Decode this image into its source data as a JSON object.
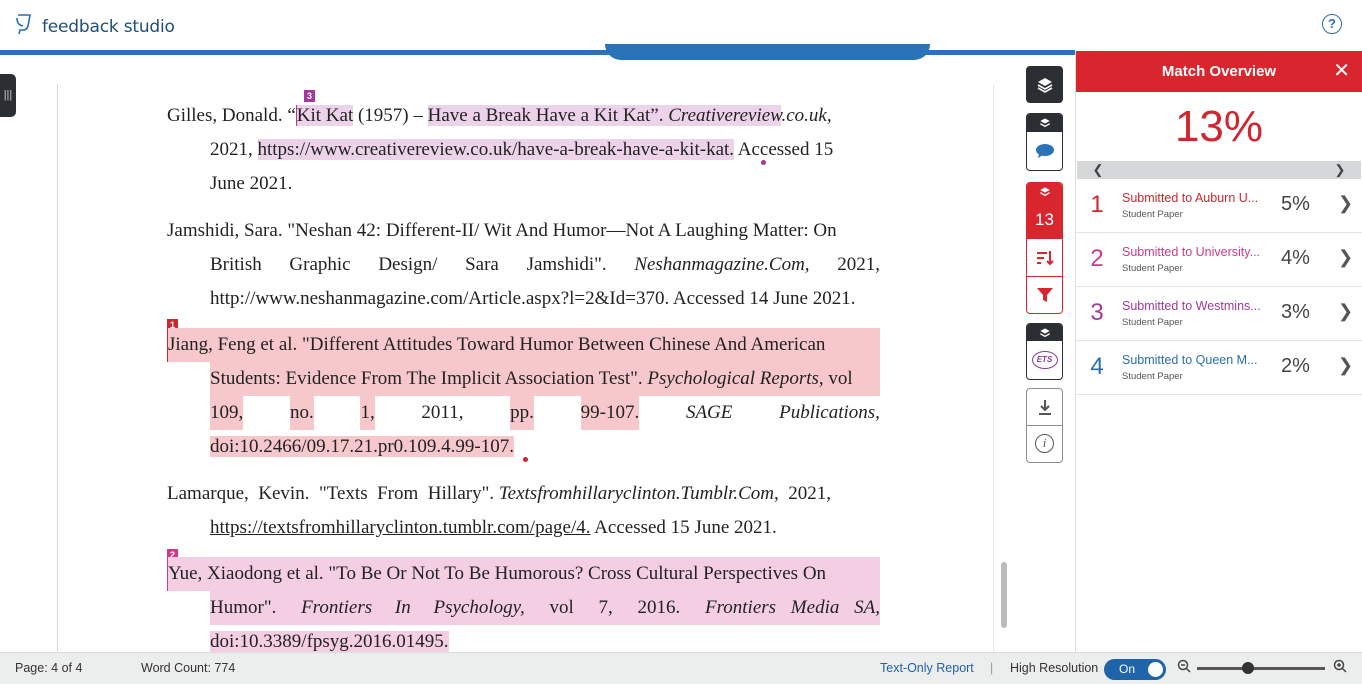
{
  "app": {
    "title": "feedback studio"
  },
  "colors": {
    "accent": "#2a73b8",
    "match_red": "#d0262f",
    "match_purple": "#a2399b",
    "match_pink": "#d0398a",
    "match_blue": "#2a6fb0"
  },
  "document": {
    "refs": [
      {
        "marker": "3",
        "line1": {
          "before": "Gilles, Donald. “",
          "hl1": "Kit Kat",
          "mid": " (1957) – ",
          "hl2": "Have a Break Have a Kit Kat”. ",
          "ital": "Creativereview",
          "after": ".co.uk,"
        },
        "line2": {
          "before": "2021,  ",
          "hl": "https://www.creativereview.co.uk/have-a-break-have-a-kit-kat.",
          "after": " Accessed 15"
        },
        "line3": "June 2021."
      },
      {
        "line1": "Jamshidi, Sara. \"Neshan 42: Different-II/ Wit And Humor—Not A Laughing Matter: On",
        "line2_words": [
          "British",
          "Graphic",
          "Design/",
          "Sara",
          "Jamshidi\".",
          "Neshanmagazine.Com,",
          "2021,"
        ],
        "line3": "http://www.neshanmagazine.com/Article.aspx?l=2&Id=370. Accessed 14 June 2021."
      },
      {
        "marker": "1",
        "line1": "Jiang, Feng et al. \"Different Attitudes Toward Humor Between Chinese And American",
        "line2_a": "Students: Evidence From The Implicit Association Test\". ",
        "line2_ital": "Psychological Reports",
        "line2_b": ", vol",
        "line3_words": [
          "109,",
          "no.",
          "1,",
          "2011,",
          "pp.",
          "99-107.",
          "SAGE",
          "Publications,"
        ],
        "line4": "doi:10.2466/09.17.21.pr0.109.4.99-107."
      },
      {
        "line1_a": "Lamarque,  Kevin.  \"Texts  From  Hillary\". ",
        "line1_ital": "Textsfromhillaryclinton.Tumblr.Com",
        "line1_b": ",  2021,",
        "line2_link": "https://textsfromhillaryclinton.tumblr.com/page/4.",
        "line2_after": " Accessed 15 June 2021."
      },
      {
        "marker": "2",
        "line1": "Yue, Xiaodong et al. \"To Be Or Not To Be Humorous? Cross Cultural Perspectives On",
        "line2_words": [
          "Humor\".",
          "Frontiers In Psychology,",
          "vol",
          "7,",
          "2016.",
          "Frontiers Media SA,"
        ],
        "line3": "doi:10.3389/fpsyg.2016.01495."
      }
    ]
  },
  "tools": {
    "match_count": "13",
    "ets_label": "ETS"
  },
  "panel": {
    "title": "Match Overview",
    "percentage": "13%",
    "matches": [
      {
        "num": "1",
        "source": "Submitted to Auburn U...",
        "type": "Student Paper",
        "pct": "5%",
        "color": "#d0262f"
      },
      {
        "num": "2",
        "source": "Submitted to University...",
        "type": "Student Paper",
        "pct": "4%",
        "color": "#d0398a"
      },
      {
        "num": "3",
        "source": "Submitted to Westmins...",
        "type": "Student Paper",
        "pct": "3%",
        "color": "#a2399b"
      },
      {
        "num": "4",
        "source": "Submitted to Queen M...",
        "type": "Student Paper",
        "pct": "2%",
        "color": "#2a6fb0"
      }
    ]
  },
  "status": {
    "page": "Page: 4 of 4",
    "word_count": "Word Count: 774",
    "text_only": "Text-Only Report",
    "separator": "|",
    "high_res": "High Resolution",
    "toggle": "On",
    "zoom_level": 0.39
  }
}
